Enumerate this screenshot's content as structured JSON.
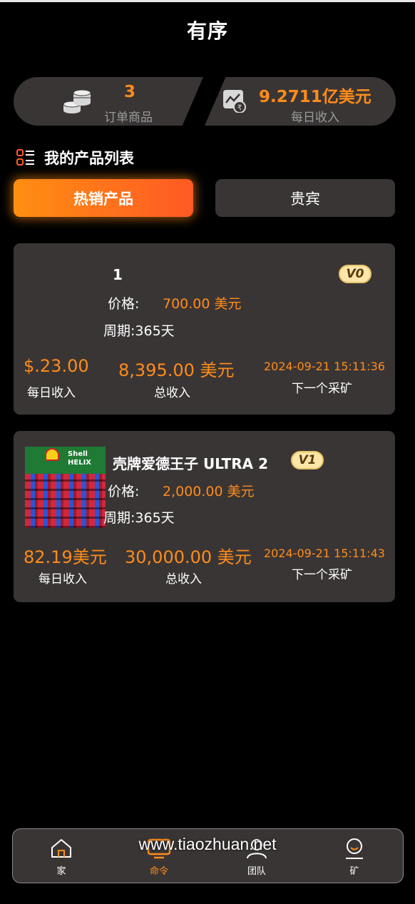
{
  "header": {
    "title": "有序"
  },
  "stats": {
    "orders": {
      "value": "3",
      "label": "订单商品",
      "icon": "coins-icon"
    },
    "daily": {
      "value": "9.2711亿美元",
      "label": "每日收入",
      "icon": "rupee-trend-icon"
    }
  },
  "list": {
    "title": "我的产品列表",
    "icon": "list-icon"
  },
  "tabs": [
    {
      "label": "热销产品",
      "active": true
    },
    {
      "label": "贵宾",
      "active": false
    }
  ],
  "products": [
    {
      "name": "1",
      "badge": "V0",
      "price_key": "价格:",
      "price_val": "700.00 美元",
      "period": "周期:365天",
      "daily_val": "$.23.00",
      "daily_lbl": "每日收入",
      "total_val": "8,395.00 美元",
      "total_lbl": "总收入",
      "next_time": "2024-09-21 15:11:36",
      "next_lbl": "下一个采矿"
    },
    {
      "name": "壳牌爱德王子 ULTRA 2",
      "badge": "V1",
      "image_text": "Shell HELIX",
      "price_key": "价格:",
      "price_val": "2,000.00 美元",
      "period": "周期:365天",
      "daily_val": "82.19美元",
      "daily_lbl": "每日收入",
      "total_val": "30,000.00 美元",
      "total_lbl": "总收入",
      "next_time": "2024-09-21 15:11:43",
      "next_lbl": "下一个采矿"
    }
  ],
  "nav": [
    {
      "label": "家",
      "icon": "home-icon",
      "active": false
    },
    {
      "label": "命令",
      "icon": "monitor-icon",
      "active": true
    },
    {
      "label": "团队",
      "icon": "team-icon",
      "active": false
    },
    {
      "label": "矿",
      "icon": "user-icon",
      "active": false
    }
  ],
  "watermark": "www.tiaozhuan.net",
  "colors": {
    "accent": "#ff8c1a",
    "card": "#3a3535",
    "background": "#000000"
  }
}
